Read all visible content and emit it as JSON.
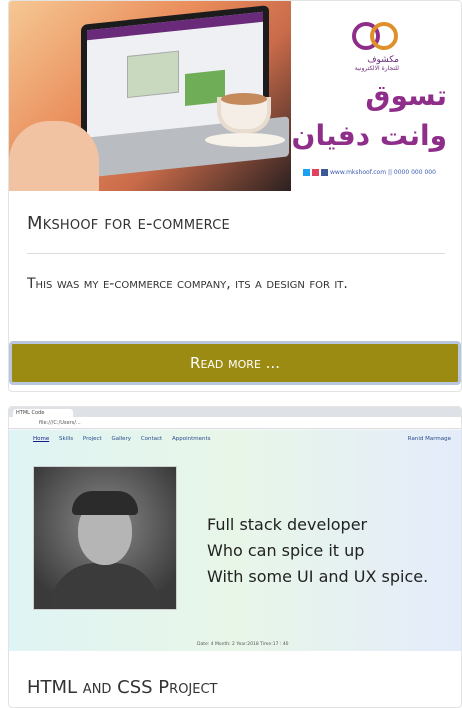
{
  "cards": [
    {
      "image": {
        "logo_caption": "مكشوف",
        "logo_subcaption": "للتجارة الالكترونية",
        "headline_line1": "تسوق",
        "headline_line2": "وانت دفيان",
        "contact": "www.mkshoof.com || 0000 000 000"
      },
      "title": "Mkshoof for e-commerce",
      "description": "This was my e-commerce company, its a design for it.",
      "button_label": "Read more ..."
    },
    {
      "image": {
        "browser_tab": "HTML Code",
        "browser_url": "file:///C:/Users/...",
        "nav": [
          "Home",
          "Skills",
          "Project",
          "Gallery",
          "Contact",
          "Appointments"
        ],
        "user": "Ranid Marmage",
        "tagline": [
          "Full stack developer",
          "Who can spice it up",
          "With some UI and UX spice."
        ],
        "date": "Date: 4  Month: 2  Year:2018  Time:17 : 40"
      },
      "title": "HTML and CSS Project"
    }
  ],
  "colors": {
    "button_bg": "#9c8b12",
    "button_border": "#b9c7de",
    "brand_purple": "#8e2d8a"
  }
}
